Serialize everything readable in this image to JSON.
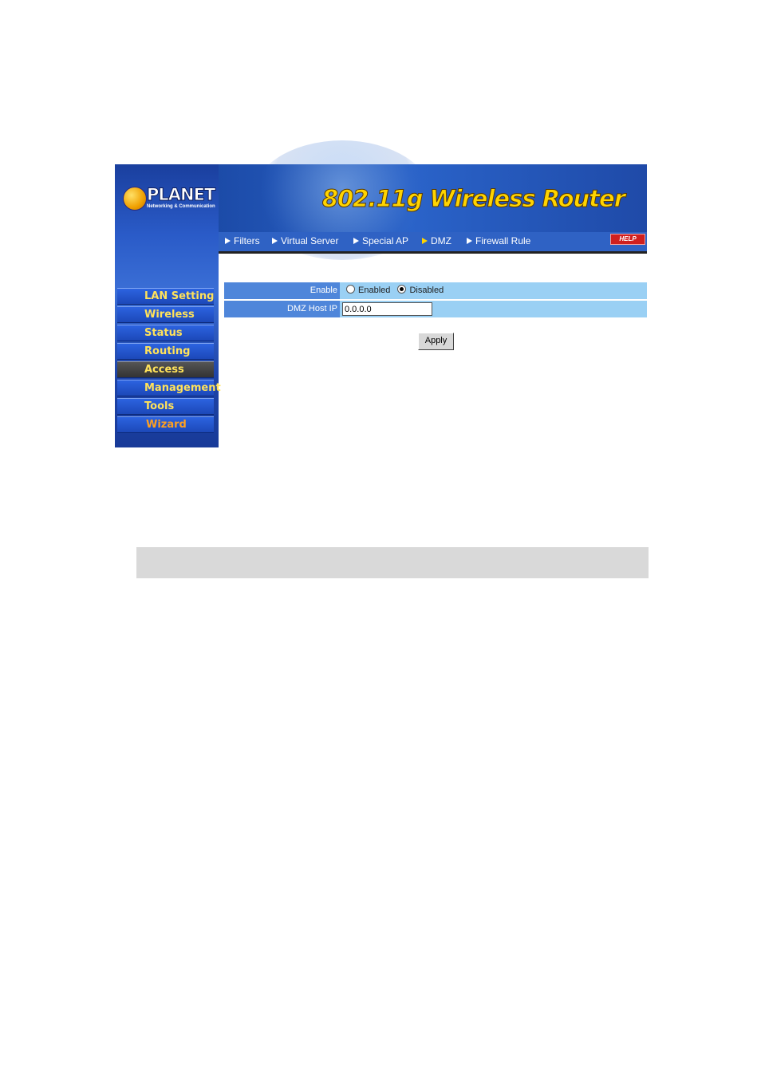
{
  "brand": {
    "logo_text": "PLANET",
    "logo_tagline": "Networking & Communication"
  },
  "header": {
    "title": "802.11g Wireless Router"
  },
  "topnav": {
    "tabs": [
      {
        "label": "Filters"
      },
      {
        "label": "Virtual Server"
      },
      {
        "label": "Special AP"
      },
      {
        "label": "DMZ",
        "active": true
      },
      {
        "label": "Firewall Rule"
      }
    ],
    "help_label": "HELP"
  },
  "sidebar": {
    "items": [
      {
        "label": "LAN Setting"
      },
      {
        "label": "Wireless"
      },
      {
        "label": "Status"
      },
      {
        "label": "Routing"
      },
      {
        "label": "Access",
        "active": true
      },
      {
        "label": "Management"
      },
      {
        "label": "Tools"
      },
      {
        "label": "Wizard"
      }
    ]
  },
  "form": {
    "enable_label": "Enable",
    "enabled_option": "Enabled",
    "disabled_option": "Disabled",
    "selected": "Disabled",
    "host_ip_label": "DMZ Host IP",
    "host_ip_value": "0.0.0.0",
    "apply_label": "Apply"
  },
  "colors": {
    "accent_yellow": "#ffd400",
    "nav_blue": "#2f62c4",
    "row_light": "#9ad0f4",
    "row_label": "#4f86da"
  }
}
